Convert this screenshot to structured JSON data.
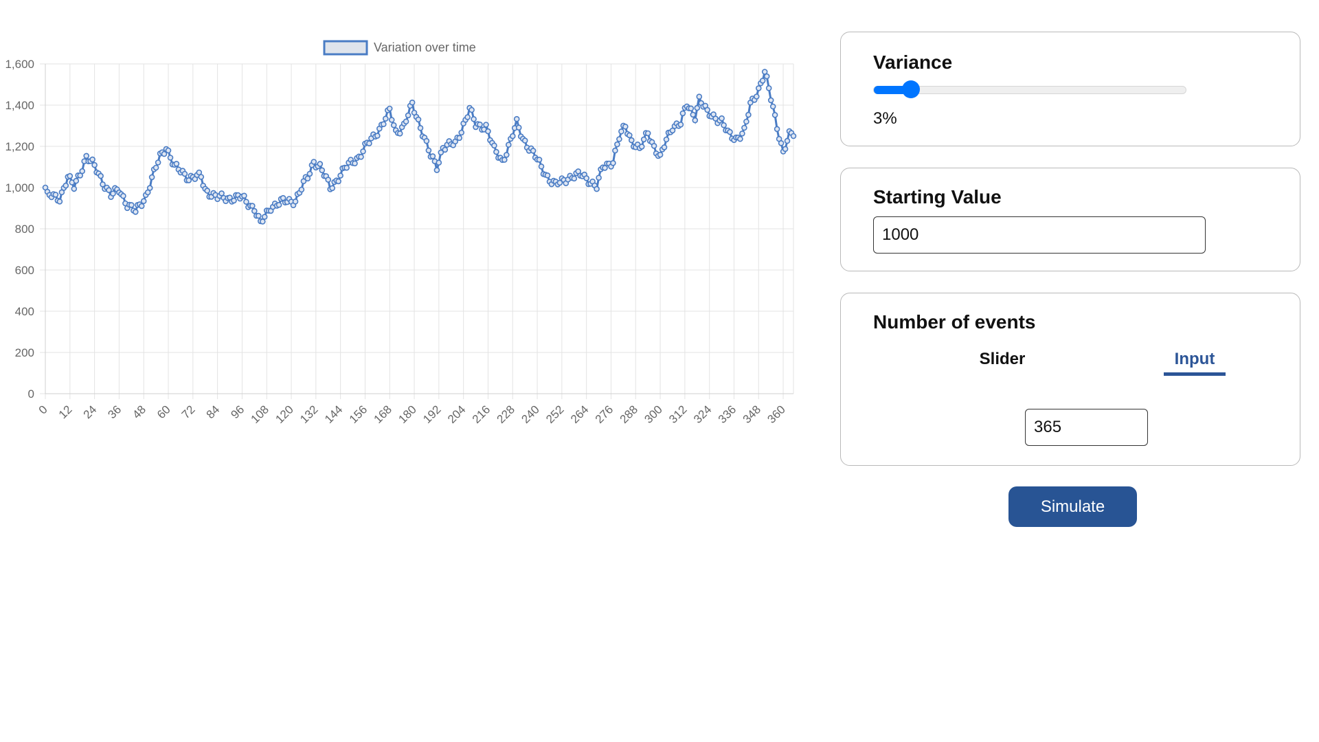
{
  "chart_data": {
    "type": "line",
    "legend": {
      "label": "Variation over time",
      "position": "top"
    },
    "x": {
      "min": 0,
      "max": 365,
      "step": 1,
      "tick_labels": [
        "0",
        "12",
        "24",
        "36",
        "48",
        "60",
        "72",
        "84",
        "96",
        "108",
        "120",
        "132",
        "144",
        "156",
        "168",
        "180",
        "192",
        "204",
        "216",
        "228",
        "240",
        "252",
        "264",
        "276",
        "288",
        "300",
        "312",
        "324",
        "336",
        "348",
        "360"
      ]
    },
    "y": {
      "min": 0,
      "max": 1600,
      "tick_labels": [
        "0",
        "200",
        "400",
        "600",
        "800",
        "1,000",
        "1,200",
        "1,400",
        "1,600"
      ]
    },
    "grid": true,
    "keypoints": [
      [
        0,
        1000
      ],
      [
        1,
        960
      ],
      [
        7,
        950
      ],
      [
        11,
        1050
      ],
      [
        14,
        1000
      ],
      [
        20,
        1150
      ],
      [
        24,
        1100
      ],
      [
        27,
        1050
      ],
      [
        32,
        960
      ],
      [
        36,
        990
      ],
      [
        40,
        920
      ],
      [
        44,
        880
      ],
      [
        49,
        960
      ],
      [
        56,
        1150
      ],
      [
        59,
        1200
      ],
      [
        63,
        1100
      ],
      [
        70,
        1050
      ],
      [
        76,
        1050
      ],
      [
        78,
        990
      ],
      [
        84,
        950
      ],
      [
        92,
        950
      ],
      [
        96,
        950
      ],
      [
        102,
        900
      ],
      [
        105,
        820
      ],
      [
        110,
        910
      ],
      [
        116,
        930
      ],
      [
        122,
        940
      ],
      [
        128,
        1050
      ],
      [
        131,
        1130
      ],
      [
        134,
        1100
      ],
      [
        139,
        1000
      ],
      [
        147,
        1100
      ],
      [
        150,
        1130
      ],
      [
        153,
        1150
      ],
      [
        158,
        1220
      ],
      [
        164,
        1300
      ],
      [
        168,
        1370
      ],
      [
        171,
        1270
      ],
      [
        175,
        1300
      ],
      [
        179,
        1400
      ],
      [
        183,
        1300
      ],
      [
        188,
        1150
      ],
      [
        191,
        1100
      ],
      [
        194,
        1200
      ],
      [
        200,
        1210
      ],
      [
        207,
        1380
      ],
      [
        210,
        1300
      ],
      [
        215,
        1300
      ],
      [
        219,
        1180
      ],
      [
        223,
        1130
      ],
      [
        226,
        1200
      ],
      [
        230,
        1310
      ],
      [
        233,
        1240
      ],
      [
        237,
        1180
      ],
      [
        242,
        1100
      ],
      [
        246,
        1040
      ],
      [
        249,
        1010
      ],
      [
        255,
        1050
      ],
      [
        262,
        1060
      ],
      [
        265,
        1040
      ],
      [
        269,
        1000
      ],
      [
        272,
        1100
      ],
      [
        277,
        1130
      ],
      [
        280,
        1240
      ],
      [
        283,
        1300
      ],
      [
        286,
        1230
      ],
      [
        290,
        1180
      ],
      [
        294,
        1270
      ],
      [
        297,
        1200
      ],
      [
        300,
        1140
      ],
      [
        303,
        1230
      ],
      [
        306,
        1300
      ],
      [
        310,
        1310
      ],
      [
        313,
        1400
      ],
      [
        317,
        1350
      ],
      [
        319,
        1430
      ],
      [
        323,
        1360
      ],
      [
        326,
        1350
      ],
      [
        330,
        1320
      ],
      [
        333,
        1260
      ],
      [
        337,
        1240
      ],
      [
        341,
        1270
      ],
      [
        344,
        1400
      ],
      [
        348,
        1480
      ],
      [
        351,
        1560
      ],
      [
        354,
        1430
      ],
      [
        357,
        1300
      ],
      [
        360,
        1170
      ],
      [
        363,
        1250
      ],
      [
        365,
        1260
      ]
    ],
    "color": "#4a7cc4"
  },
  "variance": {
    "title": "Variance",
    "value_label": "3%",
    "value": 3,
    "max": 25
  },
  "starting_value": {
    "title": "Starting Value",
    "value": "1000"
  },
  "events": {
    "title": "Number of events",
    "tabs": [
      "Slider",
      "Input"
    ],
    "active_tab": "Input",
    "value": "365"
  },
  "simulate": {
    "label": "Simulate"
  }
}
